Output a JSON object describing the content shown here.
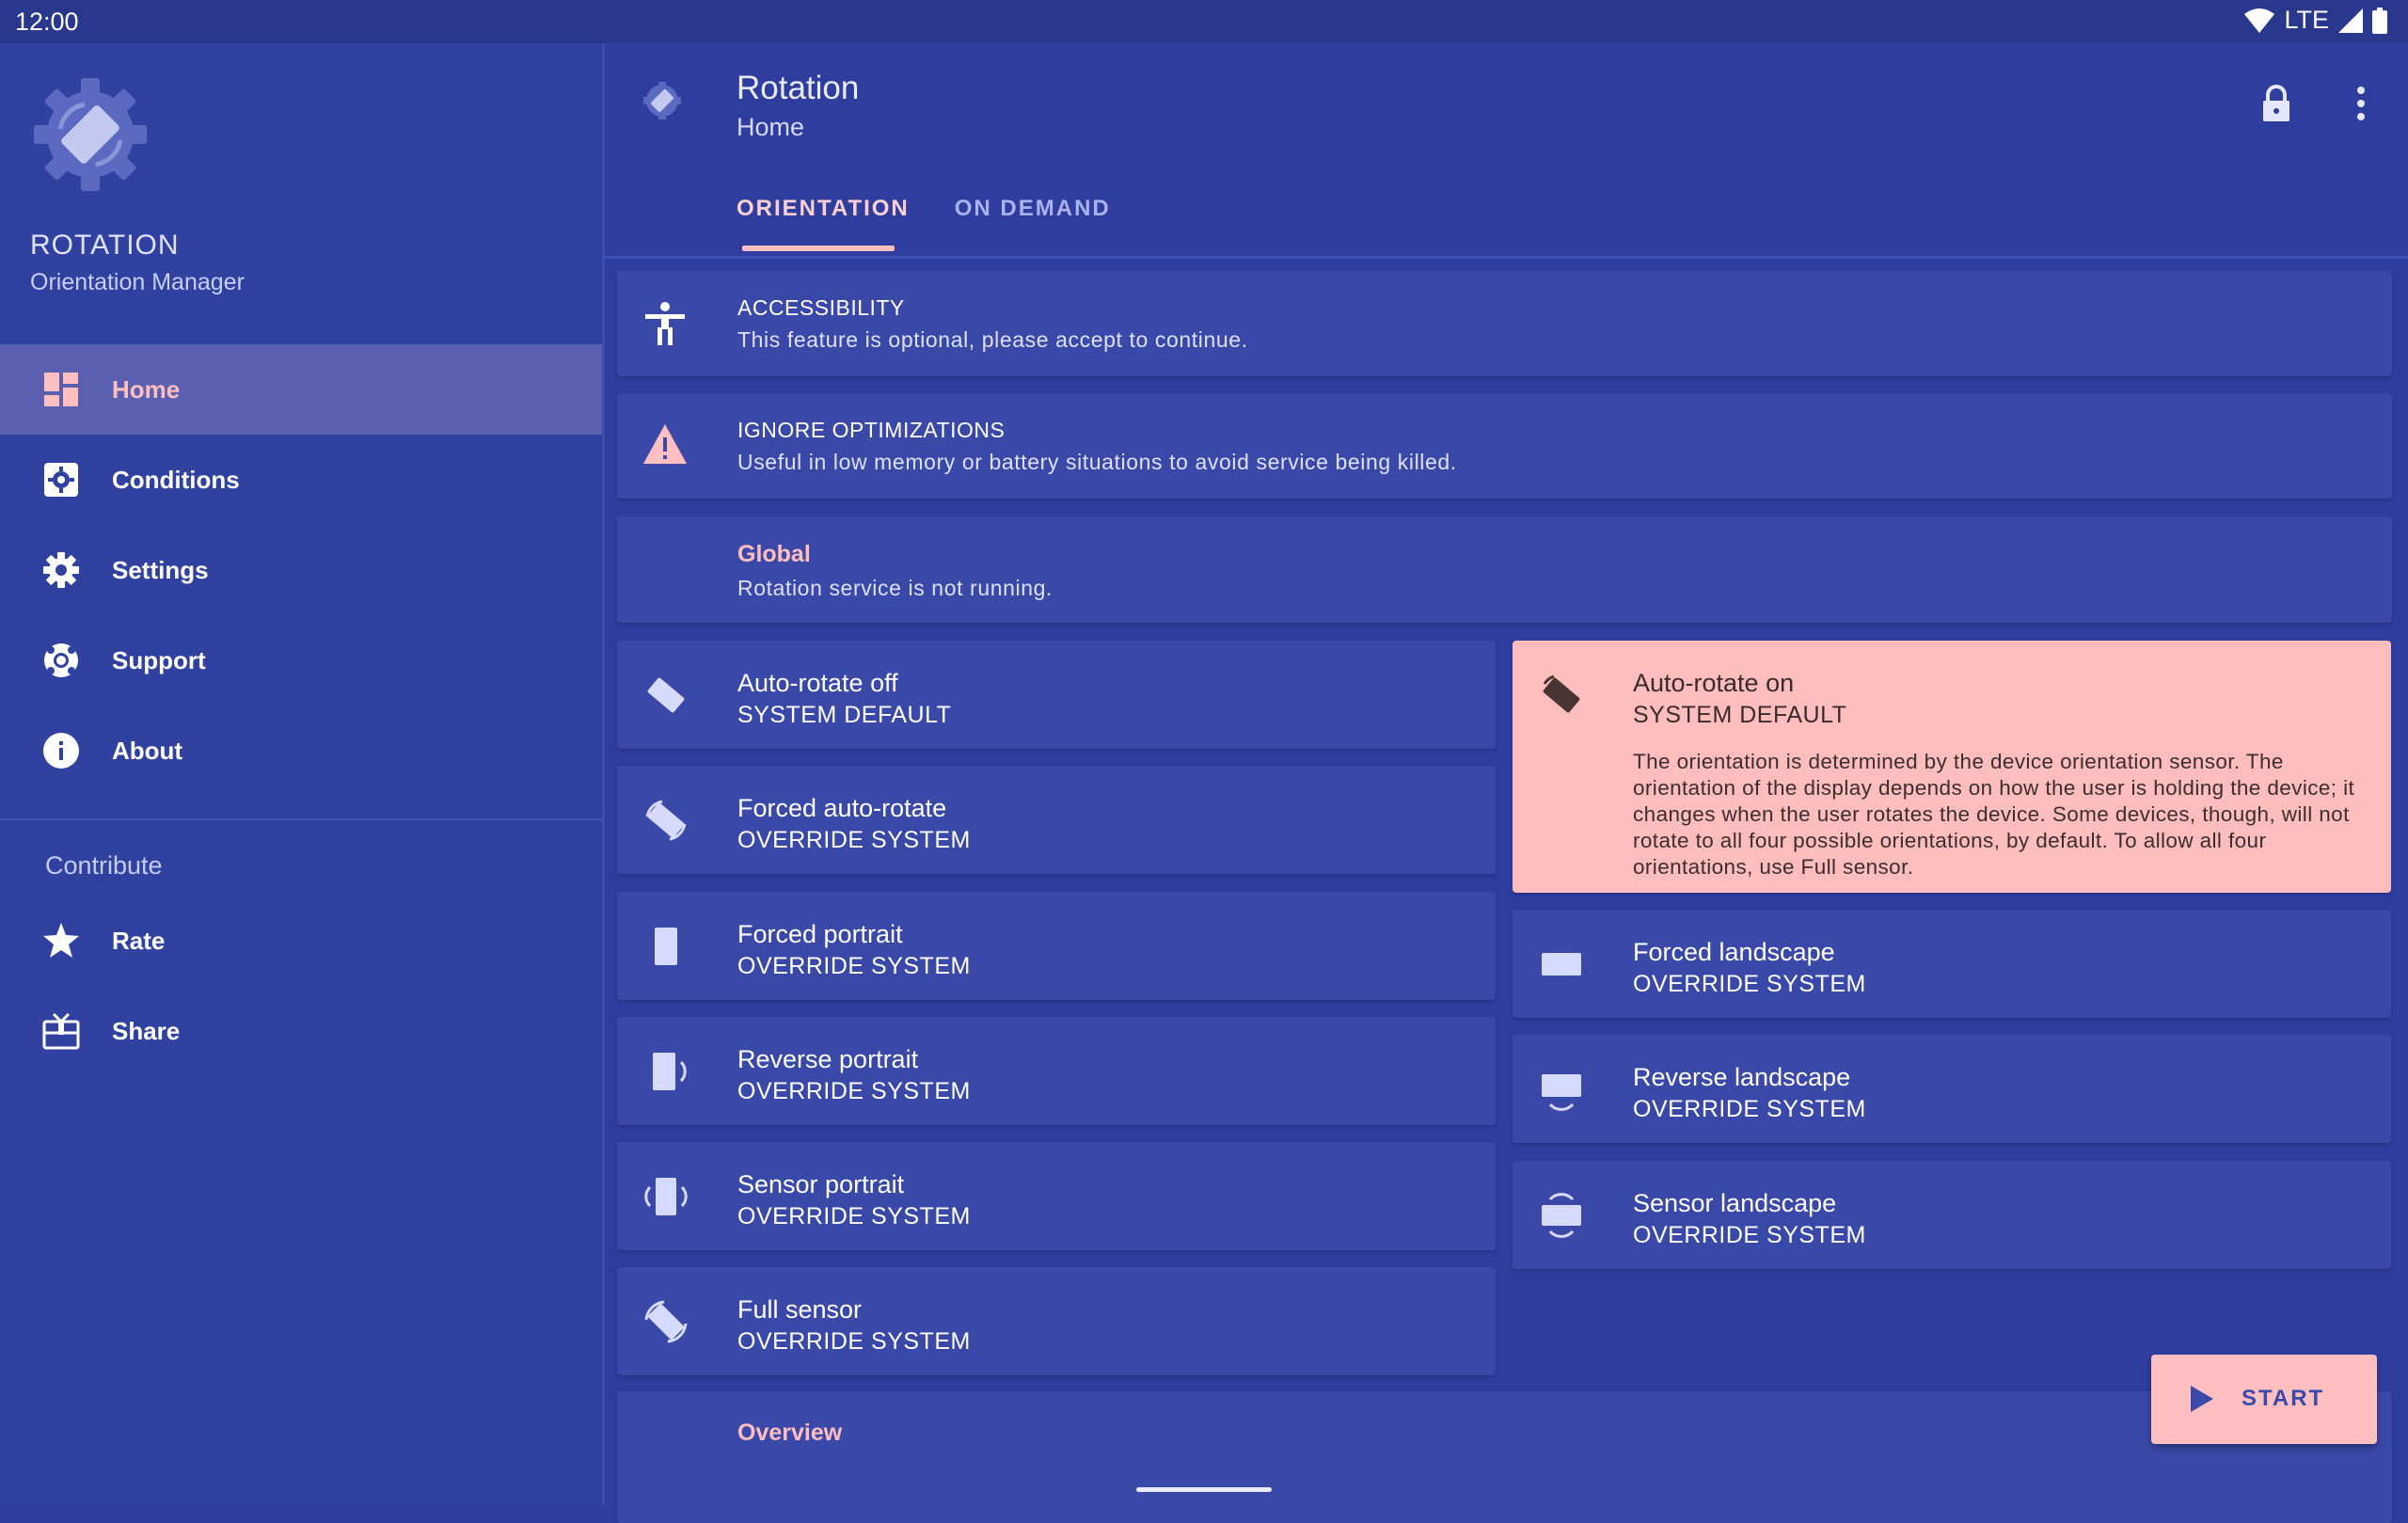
{
  "status_bar": {
    "time": "12:00",
    "network": "LTE"
  },
  "drawer": {
    "app_name": "ROTATION",
    "app_subtitle": "Orientation Manager",
    "items": [
      {
        "label": "Home",
        "icon": "dashboard-icon",
        "active": true
      },
      {
        "label": "Conditions",
        "icon": "conditions-icon",
        "active": false
      },
      {
        "label": "Settings",
        "icon": "gear-icon",
        "active": false
      },
      {
        "label": "Support",
        "icon": "lifebuoy-icon",
        "active": false
      },
      {
        "label": "About",
        "icon": "info-icon",
        "active": false
      }
    ],
    "section_label": "Contribute",
    "contribute_items": [
      {
        "label": "Rate",
        "icon": "star-icon"
      },
      {
        "label": "Share",
        "icon": "share-icon"
      }
    ]
  },
  "appbar": {
    "title": "Rotation",
    "subtitle": "Home",
    "tabs": [
      {
        "label": "ORIENTATION",
        "active": true
      },
      {
        "label": "ON DEMAND",
        "active": false
      }
    ]
  },
  "cards": {
    "accessibility": {
      "title": "ACCESSIBILITY",
      "desc": "This feature is optional, please accept to continue."
    },
    "optimizations": {
      "title": "IGNORE OPTIMIZATIONS",
      "desc": "Useful in low memory or battery situations to avoid service being killed."
    },
    "global": {
      "title": "Global",
      "desc": "Rotation service is not running."
    }
  },
  "orientations": {
    "left": [
      {
        "title": "Auto-rotate off",
        "sub": "SYSTEM DEFAULT"
      },
      {
        "title": "Forced auto-rotate",
        "sub": "OVERRIDE SYSTEM"
      },
      {
        "title": "Forced portrait",
        "sub": "OVERRIDE SYSTEM"
      },
      {
        "title": "Reverse portrait",
        "sub": "OVERRIDE SYSTEM"
      },
      {
        "title": "Sensor portrait",
        "sub": "OVERRIDE SYSTEM"
      },
      {
        "title": "Full sensor",
        "sub": "OVERRIDE SYSTEM"
      }
    ],
    "selected": {
      "title": "Auto-rotate on",
      "sub": "SYSTEM DEFAULT",
      "desc": "The orientation is determined by the device orientation sensor. The orientation of the display depends on how the user is holding the device; it changes when the user rotates the device. Some devices, though, will not rotate to all four possible orientations, by default. To allow all four orientations, use Full sensor."
    },
    "right": [
      {
        "title": "Forced landscape",
        "sub": "OVERRIDE SYSTEM"
      },
      {
        "title": "Reverse landscape",
        "sub": "OVERRIDE SYSTEM"
      },
      {
        "title": "Sensor landscape",
        "sub": "OVERRIDE SYSTEM"
      }
    ]
  },
  "overview": {
    "title": "Overview"
  },
  "fab": {
    "label": "START"
  },
  "colors": {
    "accent": "#ffbfc0",
    "background": "#2f3d9f",
    "card": "#3a49a7",
    "drawer": "#3041a0"
  }
}
